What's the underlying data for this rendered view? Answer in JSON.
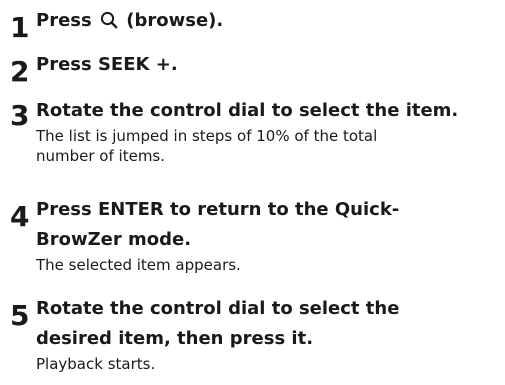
{
  "steps": [
    {
      "number": "1",
      "instruction_before_icon": "Press",
      "icon": "search-icon",
      "instruction_after_icon": "(browse).",
      "note": ""
    },
    {
      "number": "2",
      "instruction": "Press SEEK +.",
      "note": ""
    },
    {
      "number": "3",
      "instruction": "Rotate the control dial to select the item.",
      "note_line1": "The list is jumped in steps of 10% of the total",
      "note_line2": "number of items."
    },
    {
      "number": "4",
      "instruction_line1": "Press ENTER to return to the Quick-",
      "instruction_line2": "BrowZer mode.",
      "note": "The selected item appears."
    },
    {
      "number": "5",
      "instruction_line1": "Rotate the control dial to select the",
      "instruction_line2": "desired item, then press it.",
      "note": "Playback starts."
    }
  ],
  "colors": {
    "text": "#1a1a1a",
    "background": "#ffffff"
  }
}
